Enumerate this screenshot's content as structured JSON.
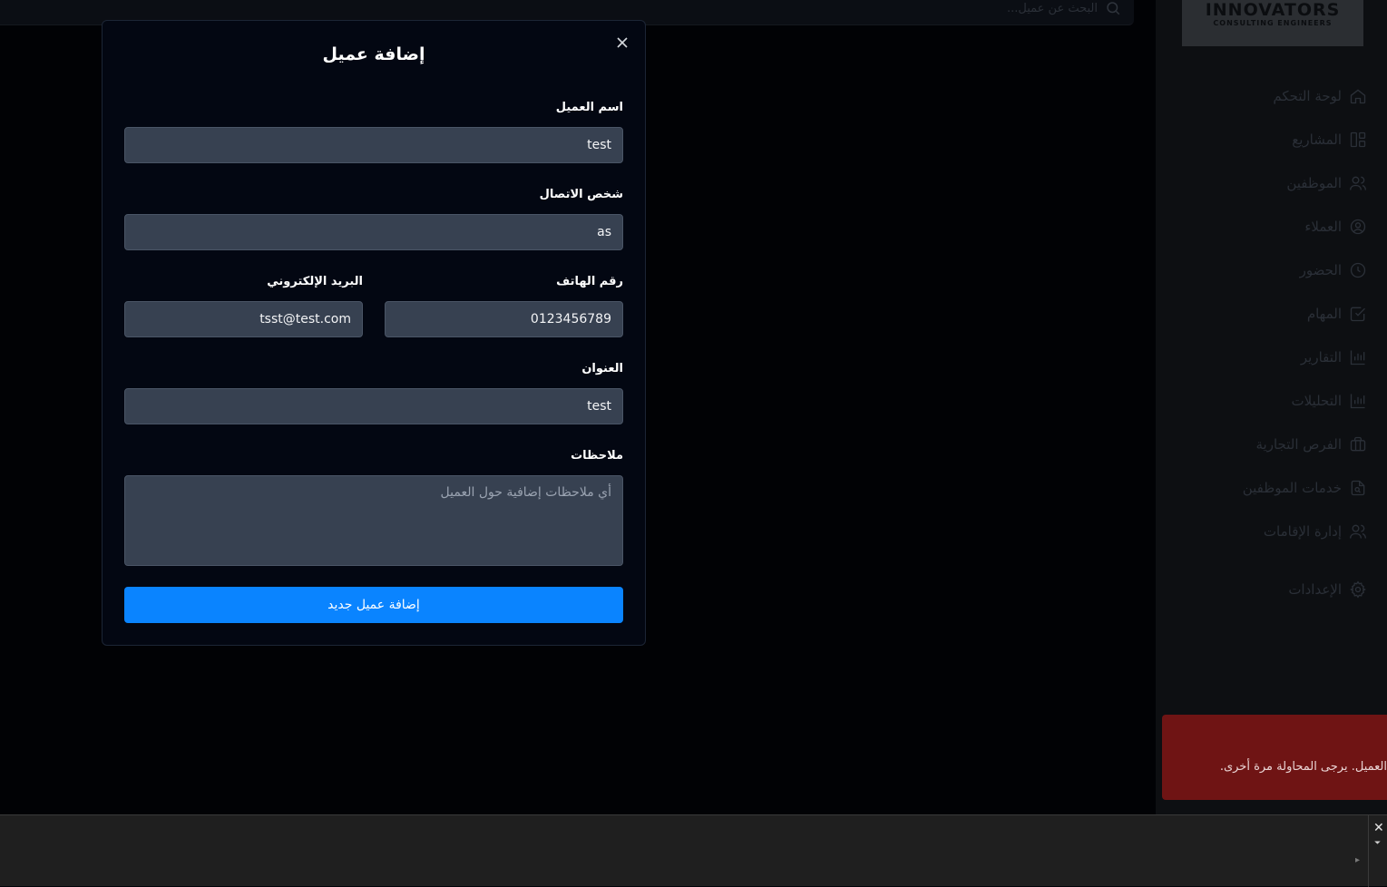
{
  "topbar": {
    "search_placeholder": "البحث عن عميل..."
  },
  "logo": {
    "line1": "INNOVATORS",
    "line2": "CONSULTING ENGINEERS"
  },
  "sidebar": {
    "items": [
      {
        "label": "لوحة التحكم",
        "icon": "home-icon"
      },
      {
        "label": "المشاريع",
        "icon": "layout-icon"
      },
      {
        "label": "الموظفين",
        "icon": "users-icon"
      },
      {
        "label": "العملاء",
        "icon": "user-circle-icon"
      },
      {
        "label": "الحضور",
        "icon": "clock-icon"
      },
      {
        "label": "المهام",
        "icon": "checkbox-icon"
      },
      {
        "label": "التقارير",
        "icon": "bar-chart-icon"
      },
      {
        "label": "التحليلات",
        "icon": "bar-chart-icon"
      },
      {
        "label": "الفرص التجارية",
        "icon": "briefcase-icon"
      },
      {
        "label": "خدمات الموظفين",
        "icon": "file-search-icon"
      },
      {
        "label": "إدارة الإقامات",
        "icon": "users-icon"
      }
    ],
    "settings": {
      "label": "الإعدادات",
      "icon": "gear-icon"
    }
  },
  "toast": {
    "message": "العميل. يرجى المحاولة مرة أخرى."
  },
  "modal": {
    "title": "إضافة عميل",
    "fields": {
      "client_name": {
        "label": "اسم العميل",
        "value": "test"
      },
      "contact_person": {
        "label": "شخص الاتصال",
        "value": "as"
      },
      "phone": {
        "label": "رقم الهاتف",
        "value": "0123456789"
      },
      "email": {
        "label": "البريد الإلكتروني",
        "value": "tsst@test.com"
      },
      "address": {
        "label": "العنوان",
        "value": "test"
      },
      "notes": {
        "label": "ملاحظات",
        "value": "",
        "placeholder": "أي ملاحظات إضافية حول العميل"
      }
    },
    "submit_label": "إضافة عميل جديد"
  },
  "bottom_panel": {
    "close": "✕",
    "collapse": "⏷",
    "expand": "▸"
  },
  "colors": {
    "accent": "#0a84ff",
    "toast_bg": "#6f1414",
    "field_bg": "#374151",
    "modal_bg": "#030712"
  }
}
